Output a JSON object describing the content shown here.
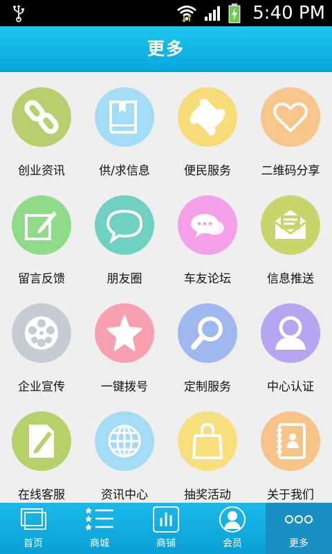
{
  "status_bar": {
    "time": "5:40 PM"
  },
  "header": {
    "title": "更多"
  },
  "grid": {
    "items": [
      {
        "label": "创业资讯",
        "icon": "link-icon",
        "color": "#b7cf6e"
      },
      {
        "label": "供/求信息",
        "icon": "book-icon",
        "color": "#a3dcf6"
      },
      {
        "label": "便民服务",
        "icon": "puzzle-icon",
        "color": "#f8dc7a"
      },
      {
        "label": "二维码分享",
        "icon": "heart-icon",
        "color": "#f8c68a"
      },
      {
        "label": "留言反馈",
        "icon": "edit-icon",
        "color": "#8fdb8a"
      },
      {
        "label": "朋友圈",
        "icon": "chat-bubble-icon",
        "color": "#6fd0c3"
      },
      {
        "label": "车友论坛",
        "icon": "chat-dots-icon",
        "color": "#f5a0e8"
      },
      {
        "label": "信息推送",
        "icon": "mail-icon",
        "color": "#c9d46a"
      },
      {
        "label": "企业宣传",
        "icon": "film-reel-icon",
        "color": "#c5ccd3"
      },
      {
        "label": "一键拨号",
        "icon": "star-icon",
        "color": "#f89fb0"
      },
      {
        "label": "定制服务",
        "icon": "magnifier-icon",
        "color": "#9fb8ef"
      },
      {
        "label": "中心认证",
        "icon": "user-icon",
        "color": "#b8a5f1"
      },
      {
        "label": "在线客服",
        "icon": "document-edit-icon",
        "color": "#b6d06a"
      },
      {
        "label": "资讯中心",
        "icon": "globe-icon",
        "color": "#a4dbf5"
      },
      {
        "label": "抽奖活动",
        "icon": "shopping-bag-icon",
        "color": "#f8df7e"
      },
      {
        "label": "关于我们",
        "icon": "contact-book-icon",
        "color": "#f8c489"
      }
    ]
  },
  "bottom_nav": {
    "tabs": [
      {
        "label": "首页",
        "icon": "home-layers-icon"
      },
      {
        "label": "商城",
        "icon": "star-list-icon"
      },
      {
        "label": "商铺",
        "icon": "bar-chart-icon"
      },
      {
        "label": "会员",
        "icon": "member-avatar-icon"
      },
      {
        "label": "更多",
        "icon": "more-dots-icon"
      }
    ],
    "active_index": 4
  }
}
